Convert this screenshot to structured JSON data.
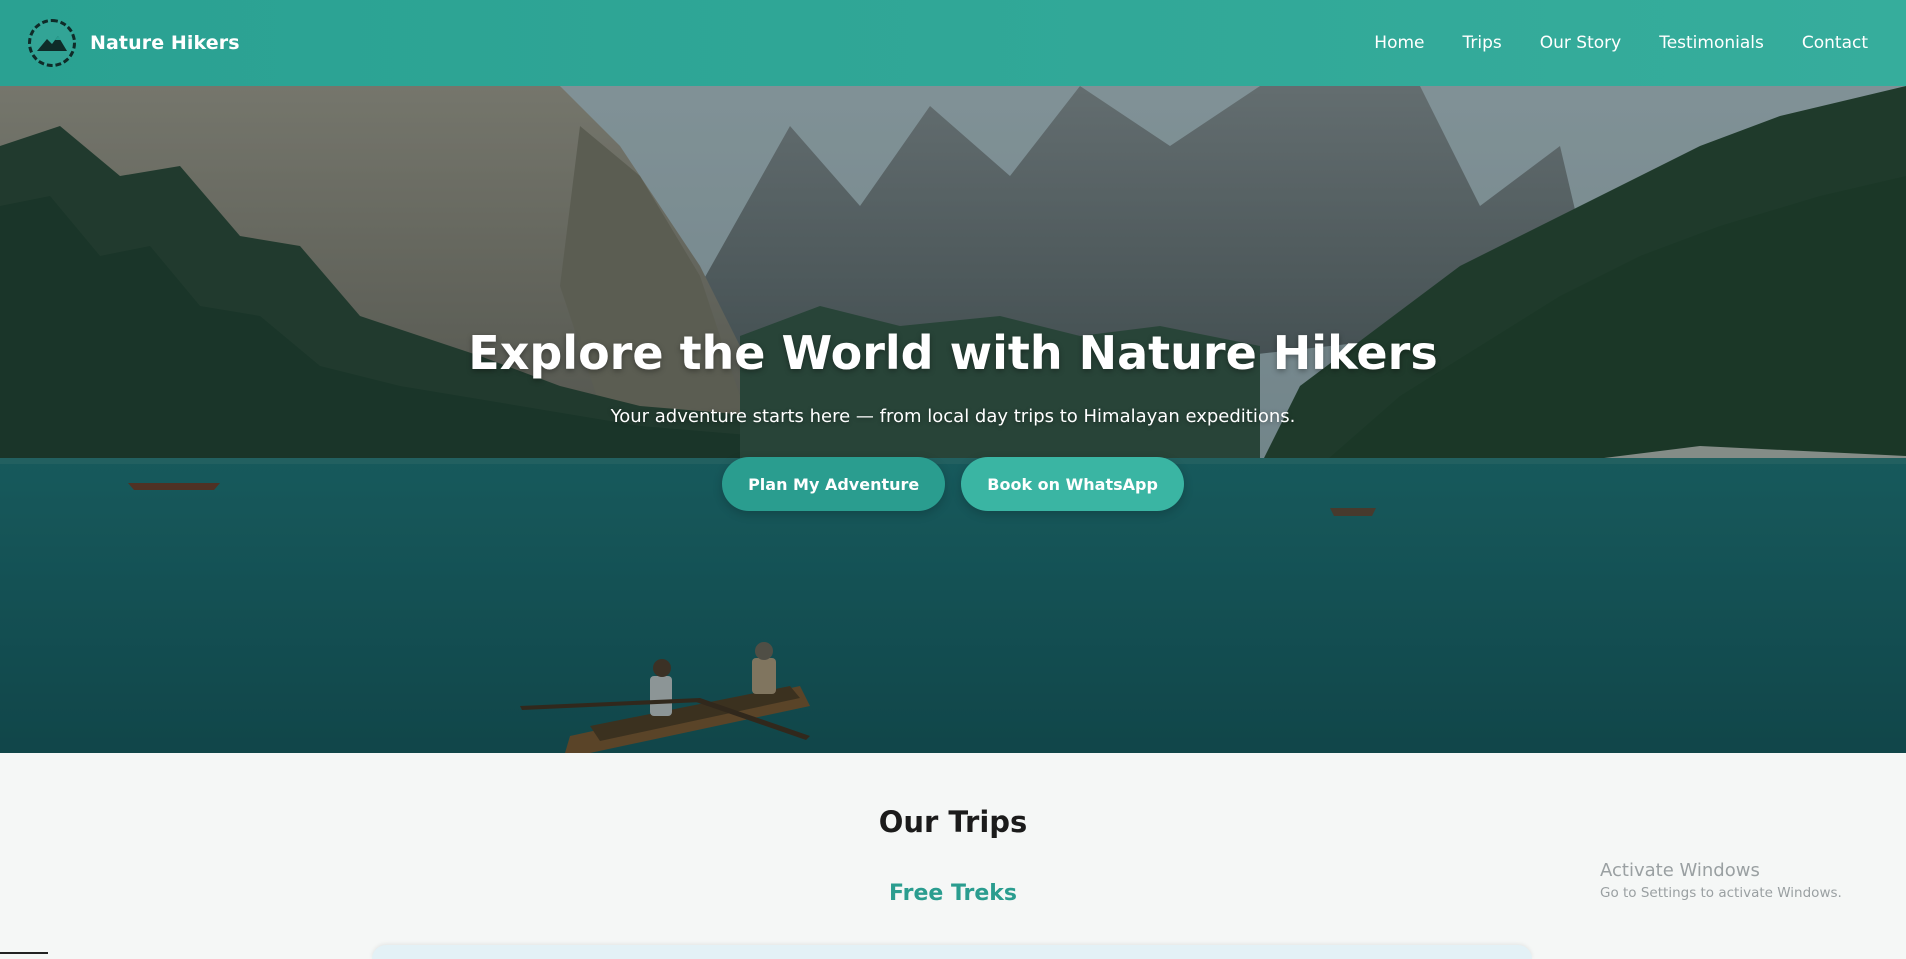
{
  "navbar": {
    "brand_name": "Nature Hikers",
    "links": [
      "Home",
      "Trips",
      "Our Story",
      "Testimonials",
      "Contact"
    ]
  },
  "hero": {
    "title": "Explore the World with Nature Hikers",
    "subtitle": "Your adventure starts here — from local day trips to Himalayan expeditions.",
    "primary_button": "Plan My Adventure",
    "secondary_button": "Book on WhatsApp"
  },
  "trips": {
    "section_title": "Our Trips",
    "category_title": "Free Treks"
  },
  "watermark": {
    "title": "Activate Windows",
    "subtitle": "Go to Settings to activate Windows."
  },
  "colors": {
    "accent": "#2a9d8f",
    "accent_light": "#3ab5a3",
    "navbar": "#2aa192",
    "background": "#f5f7f6"
  },
  "icons": {
    "logo": "mountain-circle-logo-icon"
  }
}
